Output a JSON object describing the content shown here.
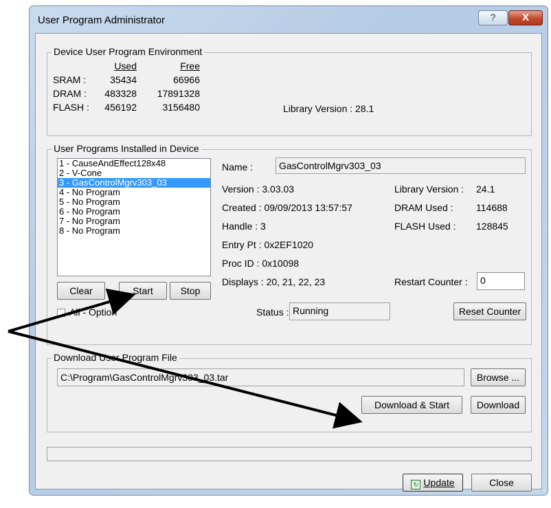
{
  "window": {
    "title": "User Program Administrator",
    "help_glyph": "?",
    "close_glyph": "X"
  },
  "env": {
    "legend": "Device User Program Environment",
    "col_used": "Used",
    "col_free": "Free",
    "rows": [
      {
        "label": "SRAM :",
        "used": "35434",
        "free": "66966"
      },
      {
        "label": "DRAM :",
        "used": "483328",
        "free": "17891328"
      },
      {
        "label": "FLASH :",
        "used": "456192",
        "free": "3156480"
      }
    ],
    "library_version": "Library Version : 28.1"
  },
  "installed": {
    "legend": "User Programs Installed in Device",
    "programs": [
      "1 - CauseAndEffect128x48",
      "2 - V-Cone",
      "3 - GasControlMgrv303_03",
      "4 - No Program",
      "5 - No Program",
      "6 - No Program",
      "7 - No Program",
      "8 - No Program"
    ],
    "selected_index": 2,
    "buttons": {
      "clear": "Clear",
      "start": "Start",
      "stop": "Stop"
    },
    "all_option": "All - Option",
    "name_label": "Name :",
    "name_value": "GasControlMgrv303_03",
    "version": "Version : 3.03.03",
    "created": "Created : 09/09/2013 13:57:57",
    "handle": "Handle : 3",
    "entry_pt": "Entry Pt : 0x2EF1020",
    "proc_id": "Proc ID : 0x10098",
    "displays": "Displays : 20, 21, 22, 23",
    "lib_version_label": "Library Version :",
    "lib_version_value": "24.1",
    "dram_used_label": "DRAM Used :",
    "dram_used_value": "114688",
    "flash_used_label": "FLASH Used :",
    "flash_used_value": "128845",
    "restart_counter_label": "Restart Counter :",
    "restart_counter_value": "0",
    "status_label": "Status :",
    "status_value": "Running",
    "reset_counter": "Reset Counter"
  },
  "download": {
    "legend": "Download User Program File",
    "path": "C:\\Program\\GasControlMgrv303_03.tar",
    "browse": "Browse ...",
    "download_start": "Download & Start",
    "download": "Download"
  },
  "footer": {
    "update": "Update",
    "close": "Close"
  }
}
